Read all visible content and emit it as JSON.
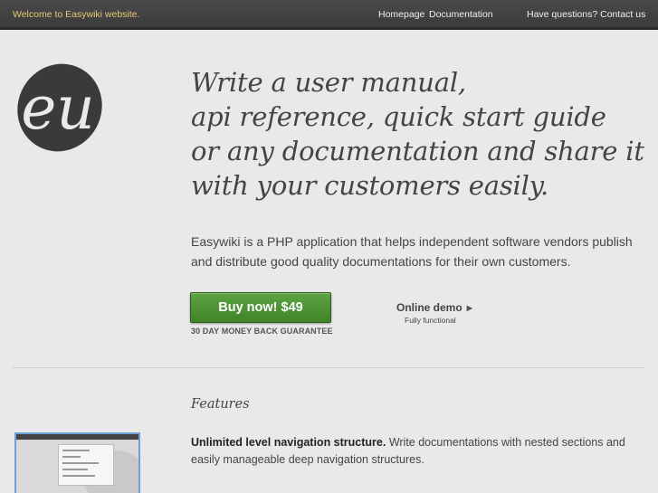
{
  "topbar": {
    "welcome": "Welcome to Easywiki website.",
    "nav": {
      "home": "Homepage",
      "docs": "Documentation",
      "contact": "Have questions? Contact us"
    }
  },
  "logo": {
    "text": "eu"
  },
  "hero": {
    "headline": [
      "Write a user manual,",
      "api reference, quick start guide",
      "or any documentation and share it",
      "with your customers easily."
    ],
    "intro": "Easywiki is a PHP application that helps independent software vendors publish and distribute good quality documentations for their own customers.",
    "buy_label": "Buy now! $49",
    "guarantee": "30 DAY MONEY BACK GUARANTEE",
    "demo_label": "Online demo",
    "demo_sub": "Fully functional"
  },
  "features": {
    "title": "Features",
    "items": [
      {
        "title": "Unlimited level navigation structure.",
        "text": "Write documentations with nested sections and easily manageable deep navigation structures."
      }
    ]
  },
  "colors": {
    "topbar": "#3f3f3f",
    "welcome": "#e8c872",
    "buy_button": "#4d9536",
    "background": "#e9e9e9"
  }
}
